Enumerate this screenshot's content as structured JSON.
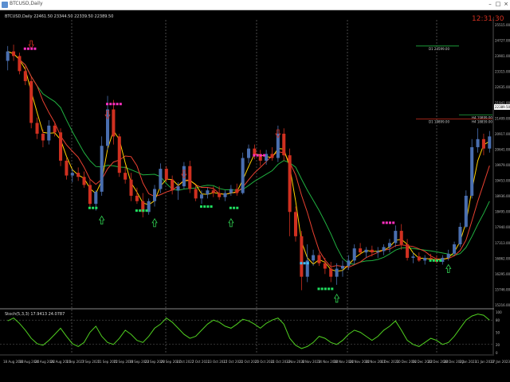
{
  "window": {
    "title": "BTCUSD,Daily",
    "min_icon": "minimize-icon",
    "max_icon": "maximize-icon",
    "close_icon": "close-icon"
  },
  "chart_info": "BTCUSD,Daily 22461.50 23344.50 22339.50 22389.50",
  "clock": "12:31:30",
  "indicator_label": "Stoch(5,3,3) 17.9413 24.0787",
  "h1_label": "D1 24599.00",
  "h4_label_1": "H4 19899.00",
  "h4_label_2": "D1 19899.00",
  "h4_label_3": "H4 18859.00",
  "price_tag": "22389.50",
  "colors": {
    "bull": "#4a6fb0",
    "bear": "#d03020",
    "fast_ma": "#ffd000",
    "mid_ma": "#e84030",
    "slow_ma": "#20b040",
    "stoch": "#50d020",
    "clock": "#d03020"
  },
  "chart_data": {
    "type": "candlestick",
    "series": [
      {
        "name": "",
        "values": [
          {
            "o": 24100,
            "h": 24650,
            "l": 23750,
            "c": 24450
          },
          {
            "o": 24450,
            "h": 24700,
            "l": 24100,
            "c": 24280
          },
          {
            "o": 24280,
            "h": 24400,
            "l": 23600,
            "c": 23720
          },
          {
            "o": 23720,
            "h": 23900,
            "l": 23200,
            "c": 23350
          },
          {
            "o": 23350,
            "h": 23500,
            "l": 21600,
            "c": 21800
          },
          {
            "o": 21800,
            "h": 22000,
            "l": 21200,
            "c": 21400
          },
          {
            "o": 21400,
            "h": 21550,
            "l": 20900,
            "c": 21150
          },
          {
            "o": 21150,
            "h": 21900,
            "l": 21000,
            "c": 21700
          },
          {
            "o": 21700,
            "h": 21850,
            "l": 21300,
            "c": 21450
          },
          {
            "o": 21450,
            "h": 21600,
            "l": 20200,
            "c": 20400
          },
          {
            "o": 20400,
            "h": 20500,
            "l": 19700,
            "c": 19850
          },
          {
            "o": 19850,
            "h": 20100,
            "l": 19600,
            "c": 19950
          },
          {
            "o": 19950,
            "h": 20150,
            "l": 19650,
            "c": 19800
          },
          {
            "o": 19800,
            "h": 20000,
            "l": 19400,
            "c": 19500
          },
          {
            "o": 19500,
            "h": 19700,
            "l": 18700,
            "c": 18800
          },
          {
            "o": 18800,
            "h": 19300,
            "l": 18550,
            "c": 19250
          },
          {
            "o": 19250,
            "h": 21300,
            "l": 19100,
            "c": 20950
          },
          {
            "o": 20950,
            "h": 22800,
            "l": 20800,
            "c": 22300
          },
          {
            "o": 22300,
            "h": 22650,
            "l": 21000,
            "c": 21300
          },
          {
            "o": 21300,
            "h": 21400,
            "l": 19800,
            "c": 19950
          },
          {
            "o": 19950,
            "h": 20200,
            "l": 19550,
            "c": 19700
          },
          {
            "o": 19700,
            "h": 19950,
            "l": 18900,
            "c": 19100
          },
          {
            "o": 19100,
            "h": 19400,
            "l": 18800,
            "c": 18900
          },
          {
            "o": 18900,
            "h": 19200,
            "l": 18300,
            "c": 18500
          },
          {
            "o": 18500,
            "h": 19000,
            "l": 18400,
            "c": 18900
          },
          {
            "o": 18900,
            "h": 19500,
            "l": 18700,
            "c": 19350
          },
          {
            "o": 19350,
            "h": 20300,
            "l": 19200,
            "c": 20100
          },
          {
            "o": 20100,
            "h": 20200,
            "l": 19600,
            "c": 19700
          },
          {
            "o": 19700,
            "h": 19850,
            "l": 19150,
            "c": 19300
          },
          {
            "o": 19300,
            "h": 19600,
            "l": 18950,
            "c": 19450
          },
          {
            "o": 19450,
            "h": 20350,
            "l": 19350,
            "c": 20200
          },
          {
            "o": 20200,
            "h": 20400,
            "l": 19200,
            "c": 19350
          },
          {
            "o": 19350,
            "h": 19500,
            "l": 18900,
            "c": 19000
          },
          {
            "o": 19000,
            "h": 19300,
            "l": 18800,
            "c": 19150
          },
          {
            "o": 19150,
            "h": 19400,
            "l": 19000,
            "c": 19300
          },
          {
            "o": 19300,
            "h": 19450,
            "l": 19050,
            "c": 19200
          },
          {
            "o": 19200,
            "h": 19450,
            "l": 18950,
            "c": 19050
          },
          {
            "o": 19050,
            "h": 19300,
            "l": 18900,
            "c": 19200
          },
          {
            "o": 19200,
            "h": 19500,
            "l": 19100,
            "c": 19350
          },
          {
            "o": 19350,
            "h": 19550,
            "l": 19100,
            "c": 19200
          },
          {
            "o": 19200,
            "h": 20700,
            "l": 19150,
            "c": 20500
          },
          {
            "o": 20500,
            "h": 21000,
            "l": 20300,
            "c": 20850
          },
          {
            "o": 20850,
            "h": 21000,
            "l": 20450,
            "c": 20600
          },
          {
            "o": 20600,
            "h": 20800,
            "l": 20200,
            "c": 20400
          },
          {
            "o": 20400,
            "h": 20800,
            "l": 20250,
            "c": 20650
          },
          {
            "o": 20650,
            "h": 20900,
            "l": 20400,
            "c": 20500
          },
          {
            "o": 20500,
            "h": 21700,
            "l": 20350,
            "c": 21400
          },
          {
            "o": 21400,
            "h": 21600,
            "l": 20400,
            "c": 20600
          },
          {
            "o": 20600,
            "h": 20850,
            "l": 17600,
            "c": 18500
          },
          {
            "o": 18500,
            "h": 18700,
            "l": 17400,
            "c": 17600
          },
          {
            "o": 17600,
            "h": 17800,
            "l": 15600,
            "c": 16100
          },
          {
            "o": 16100,
            "h": 17300,
            "l": 15900,
            "c": 16700
          },
          {
            "o": 16700,
            "h": 17100,
            "l": 16500,
            "c": 16900
          },
          {
            "o": 16900,
            "h": 17000,
            "l": 16500,
            "c": 16600
          },
          {
            "o": 16600,
            "h": 16800,
            "l": 16200,
            "c": 16400
          },
          {
            "o": 16400,
            "h": 16650,
            "l": 15900,
            "c": 16100
          },
          {
            "o": 16100,
            "h": 16600,
            "l": 15800,
            "c": 16400
          },
          {
            "o": 16400,
            "h": 16700,
            "l": 16100,
            "c": 16500
          },
          {
            "o": 16500,
            "h": 16900,
            "l": 16350,
            "c": 16700
          },
          {
            "o": 16700,
            "h": 17300,
            "l": 16550,
            "c": 17150
          },
          {
            "o": 17150,
            "h": 17350,
            "l": 16900,
            "c": 17000
          },
          {
            "o": 17000,
            "h": 17200,
            "l": 16800,
            "c": 17100
          },
          {
            "o": 17100,
            "h": 17250,
            "l": 16850,
            "c": 17000
          },
          {
            "o": 17000,
            "h": 17200,
            "l": 16800,
            "c": 17050
          },
          {
            "o": 17050,
            "h": 17300,
            "l": 16900,
            "c": 17200
          },
          {
            "o": 17200,
            "h": 17500,
            "l": 17000,
            "c": 17350
          },
          {
            "o": 17350,
            "h": 18000,
            "l": 17200,
            "c": 17800
          },
          {
            "o": 17800,
            "h": 18050,
            "l": 17100,
            "c": 17300
          },
          {
            "o": 17300,
            "h": 17500,
            "l": 16700,
            "c": 16800
          },
          {
            "o": 16800,
            "h": 17000,
            "l": 16600,
            "c": 16850
          },
          {
            "o": 16850,
            "h": 17000,
            "l": 16650,
            "c": 16700
          },
          {
            "o": 16700,
            "h": 16900,
            "l": 16550,
            "c": 16800
          },
          {
            "o": 16800,
            "h": 16950,
            "l": 16650,
            "c": 16750
          },
          {
            "o": 16750,
            "h": 16900,
            "l": 16600,
            "c": 16650
          },
          {
            "o": 16650,
            "h": 16900,
            "l": 16550,
            "c": 16800
          },
          {
            "o": 16800,
            "h": 17100,
            "l": 16700,
            "c": 16950
          },
          {
            "o": 16950,
            "h": 17400,
            "l": 16900,
            "c": 17300
          },
          {
            "o": 17300,
            "h": 18100,
            "l": 17200,
            "c": 17950
          },
          {
            "o": 17950,
            "h": 19300,
            "l": 17900,
            "c": 19100
          },
          {
            "o": 19100,
            "h": 21200,
            "l": 19000,
            "c": 20900
          },
          {
            "o": 20900,
            "h": 21600,
            "l": 20700,
            "c": 21200
          },
          {
            "o": 21200,
            "h": 21400,
            "l": 20600,
            "c": 20850
          },
          {
            "o": 20850,
            "h": 21500,
            "l": 20700,
            "c": 21300
          }
        ]
      }
    ],
    "stoch_values": [
      78,
      85,
      72,
      55,
      35,
      22,
      18,
      30,
      45,
      60,
      40,
      22,
      15,
      25,
      50,
      65,
      40,
      25,
      20,
      35,
      55,
      45,
      30,
      25,
      40,
      60,
      70,
      85,
      75,
      60,
      45,
      35,
      40,
      55,
      70,
      80,
      75,
      65,
      60,
      70,
      82,
      78,
      70,
      60,
      72,
      80,
      85,
      70,
      35,
      18,
      10,
      15,
      25,
      40,
      35,
      25,
      20,
      30,
      45,
      55,
      50,
      40,
      30,
      40,
      55,
      65,
      78,
      55,
      30,
      20,
      15,
      25,
      35,
      30,
      20,
      25,
      40,
      60,
      80,
      90,
      95,
      92,
      80
    ],
    "ylim": [
      15000,
      25500
    ],
    "y_ticks": [
      "25515.00",
      "24727.00",
      "23901.00",
      "23315.00",
      "22635.00",
      "21941.00",
      "21409.00",
      "20917.00",
      "20641.00",
      "19979.00",
      "19453.00",
      "18936.00",
      "18495.00",
      "17940.00",
      "17313.00",
      "16862.00",
      "16295.00",
      "15746.00",
      "15216.00"
    ],
    "stoch_ticks": [
      "100",
      "80",
      "50",
      "20",
      "0"
    ],
    "x_labels": [
      "18 Aug 2022",
      "18 Aug 2022",
      "24 Aug 2022",
      "26 Aug 2022",
      "1 Sep 2022",
      "7 Sep 2022",
      "11 Sep 2022",
      "15 Sep 2022",
      "19 Sep 2022",
      "23 Sep 2022",
      "29 Sep 2022",
      "3 Oct 2022",
      "7 Oct 2022",
      "13 Oct 2022",
      "17 Oct 2022",
      "21 Oct 2022",
      "25 Oct 2022",
      "31 Oct 2022",
      "3 Nov 2022",
      "8 Nov 2022",
      "14 Nov 2022",
      "18 Nov 2022",
      "24 Nov 2022",
      "30 Nov 2022",
      "6 Dec 2022",
      "10 Dec 2022",
      "16 Dec 2022",
      "22 Dec 2022",
      "28 Dec 2022",
      "3 Jan 2023",
      "11 Jan 2023",
      "17 Jan 2023"
    ]
  }
}
